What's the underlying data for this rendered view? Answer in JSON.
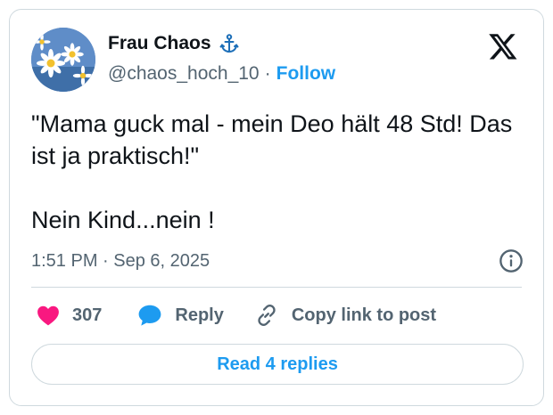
{
  "author": {
    "display_name": "Frau Chaos",
    "handle": "@chaos_hoch_10",
    "separator": "·",
    "follow_label": "Follow"
  },
  "tweet": {
    "text": "\"Mama guck mal - mein Deo hält 48 Std! Das ist ja praktisch!\"\n\nNein Kind...nein !",
    "timestamp": "1:51 PM · Sep 6, 2025"
  },
  "actions": {
    "like_count": "307",
    "reply_label": "Reply",
    "copy_link_label": "Copy link to post"
  },
  "footer": {
    "read_replies_label": "Read 4 replies"
  },
  "icons": {
    "avatar": "daisies-avatar",
    "name_badge": "anchor-icon",
    "platform": "x-logo-icon",
    "info": "info-icon",
    "like": "heart-icon",
    "reply": "speech-bubble-icon",
    "copy_link": "link-icon"
  },
  "colors": {
    "accent": "#1d9bf0",
    "like": "#f91880",
    "text": "#0f1419",
    "secondary_text": "#536471",
    "border": "#cfd9de"
  }
}
